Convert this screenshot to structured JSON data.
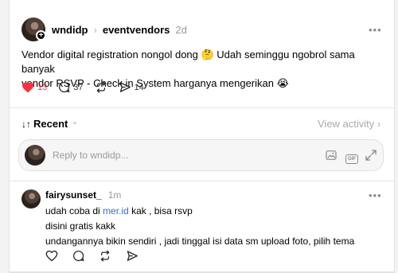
{
  "post": {
    "author": "wndidp",
    "separator": "›",
    "community": "eventvendors",
    "time": "2d",
    "more": "•••",
    "text_line1": "Vendor digital registration nongol dong 🤔 Udah seminggu ngobrol sama banyak",
    "text_line2": "vendor RSVP - Check in System harganya mengerikan 😭",
    "likes": "13",
    "comments": "37",
    "shares": "14"
  },
  "sort": {
    "label": "Recent",
    "arrows": "↓↑",
    "chevron": "⌄",
    "view_activity": "View activity ›"
  },
  "reply": {
    "placeholder": "Reply to wndidp...",
    "gif": "GIF"
  },
  "comment": {
    "author": "fairysunset_",
    "time": "1m",
    "more": "•••",
    "line1_prefix": "udah coba di ",
    "line1_link": "mer.id",
    "line1_suffix": " kak , bisa rsvp",
    "line2": "disini gratis kakk",
    "line3": "undangannya bikin sendiri , jadi tinggal isi data sm upload foto, pilih tema"
  },
  "colors": {
    "like_red": "#ff3040",
    "link_blue": "#2a73d8",
    "muted_gray": "#999999"
  },
  "icons": [
    "heart-icon",
    "comment-icon",
    "repost-icon",
    "share-icon",
    "image-icon",
    "gif-icon",
    "expand-icon",
    "plus-icon"
  ]
}
